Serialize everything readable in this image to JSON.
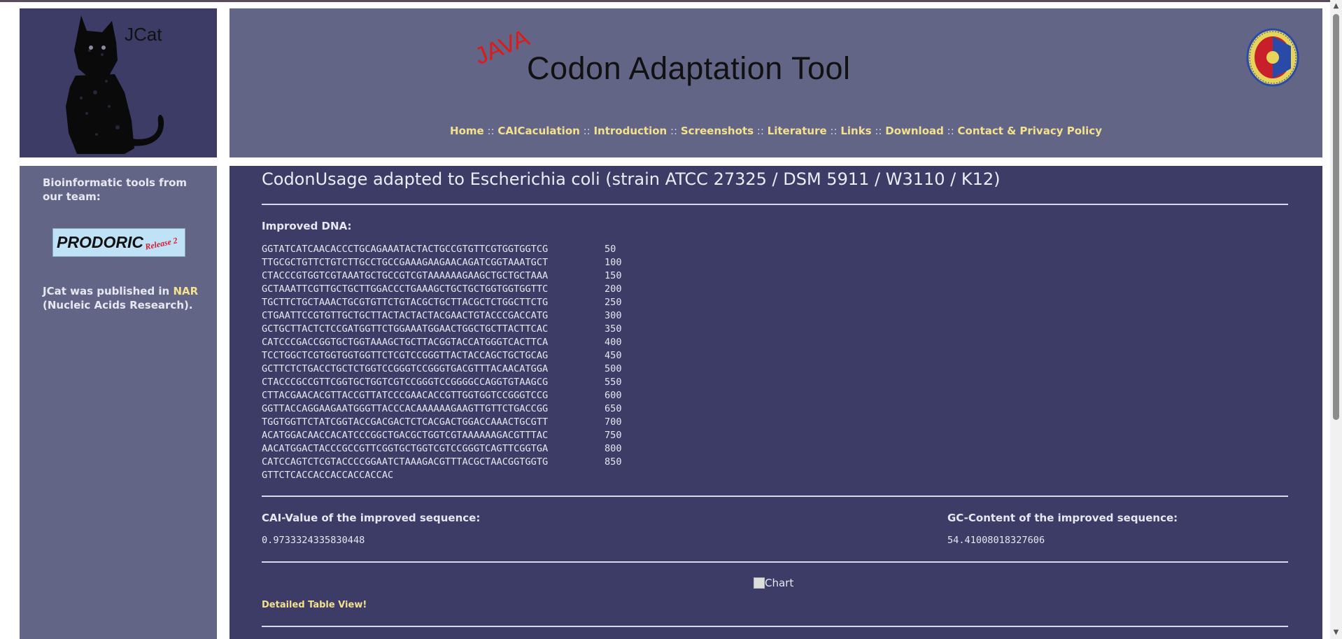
{
  "header": {
    "cat_logo_text": "JCat",
    "java_text": "JAVA",
    "title": "Codon Adaptation Tool",
    "nav": [
      {
        "label": "Home"
      },
      {
        "label": "CAICaculation"
      },
      {
        "label": "Introduction"
      },
      {
        "label": "Screenshots"
      },
      {
        "label": "Literature"
      },
      {
        "label": "Links"
      },
      {
        "label": "Download"
      },
      {
        "label": "Contact & Privacy Policy"
      }
    ],
    "nav_separator": " :: "
  },
  "sidebar": {
    "heading": "Bioinformatic tools from our team:",
    "prodoric_name": "PRODORIC",
    "prodoric_release": "Release 2",
    "published_prefix": "JCat was published in ",
    "published_link": "NAR",
    "published_suffix": "(Nucleic Acids Research)."
  },
  "main": {
    "title": "CodonUsage adapted to Escherichia coli (strain ATCC 27325 / DSM 5911 / W3110 / K12)",
    "improved_dna_label": "Improved DNA:",
    "dna_rows": [
      {
        "seq": "GGTATCATCAACACCCTGCAGAAATACTACTGCCGTGTTCGTGGTGGTCG",
        "num": "50"
      },
      {
        "seq": "TTGCGCTGTTCTGTCTTGCCTGCCGAAAGAAGAACAGATCGGTAAATGCT",
        "num": "100"
      },
      {
        "seq": "CTACCCGTGGTCGTAAATGCTGCCGTCGTAAAAAAGAAGCTGCTGCTAAA",
        "num": "150"
      },
      {
        "seq": "GCTAAATTCGTTGCTGCTTGGACCCTGAAAGCTGCTGCTGGTGGTGGTTC",
        "num": "200"
      },
      {
        "seq": "TGCTTCTGCTAAACTGCGTGTTCTGTACGCTGCTTACGCTCTGGCTTCTG",
        "num": "250"
      },
      {
        "seq": "CTGAATTCCGTGTTGCTGCTTACTACTACTACGAACTGTACCCGACCATG",
        "num": "300"
      },
      {
        "seq": "GCTGCTTACTCTCCGATGGTTCTGGAAATGGAACTGGCTGCTTACTTCAC",
        "num": "350"
      },
      {
        "seq": "CATCCCGACCGGTGCTGGTAAAGCTGCTTACGGTACCATGGGTCACTTCA",
        "num": "400"
      },
      {
        "seq": "TCCTGGCTCGTGGTGGTGGTTCTCGTCCGGGTTACTACCAGCTGCTGCAG",
        "num": "450"
      },
      {
        "seq": "GCTTCTCTGACCTGCTCTGGTCCGGGTCCGGGTGACGTTTACAACATGGA",
        "num": "500"
      },
      {
        "seq": "CTACCCGCCGTTCGGTGCTGGTCGTCCGGGTCCGGGGCCAGGTGTAAGCG",
        "num": "550"
      },
      {
        "seq": "CTTACGAACACGTTACCGTTATCCCGAACACCGTTGGTGGTCCGGGTCCG",
        "num": "600"
      },
      {
        "seq": "GGTTACCAGGAAGAATGGGTTACCCACAAAAAAGAAGTTGTTCTGACCGG",
        "num": "650"
      },
      {
        "seq": "TGGTGGTTCTATCGGTACCGACGACTCTCACGACTGGACCAAACTGCGTT",
        "num": "700"
      },
      {
        "seq": "ACATGGACAACCACATCCCGGCTGACGCTGGTCGTAAAAAAGACGTTTAC",
        "num": "750"
      },
      {
        "seq": "AACATGGACTACCCGCCGTTCGGTGCTGGTCGTCCGGGTCAGTTCGGTGA",
        "num": "800"
      },
      {
        "seq": "CATCCAGTCTCGTACCCCGGAATCTAAAGACGTTTACGCTAACGGTGGTG",
        "num": "850"
      },
      {
        "seq": "GTTCTCACCACCACCACCACCAC",
        "num": ""
      }
    ],
    "cai_label": "CAI-Value of the improved sequence:",
    "cai_value": "0.9733324335830448",
    "gc_label": "GC-Content of the improved sequence:",
    "gc_value": "54.41008018327606",
    "chart_alt": "Chart",
    "detail_link": "Detailed Table View!"
  },
  "colors": {
    "banner_bg": "#636587",
    "panel_bg": "#3c3c66",
    "link": "#f3e18e",
    "java_red": "#dd1a1a"
  },
  "icons": {
    "cat_logo": "black-cat-image",
    "seal": "university-seal-icon",
    "chart": "broken-image-icon"
  }
}
